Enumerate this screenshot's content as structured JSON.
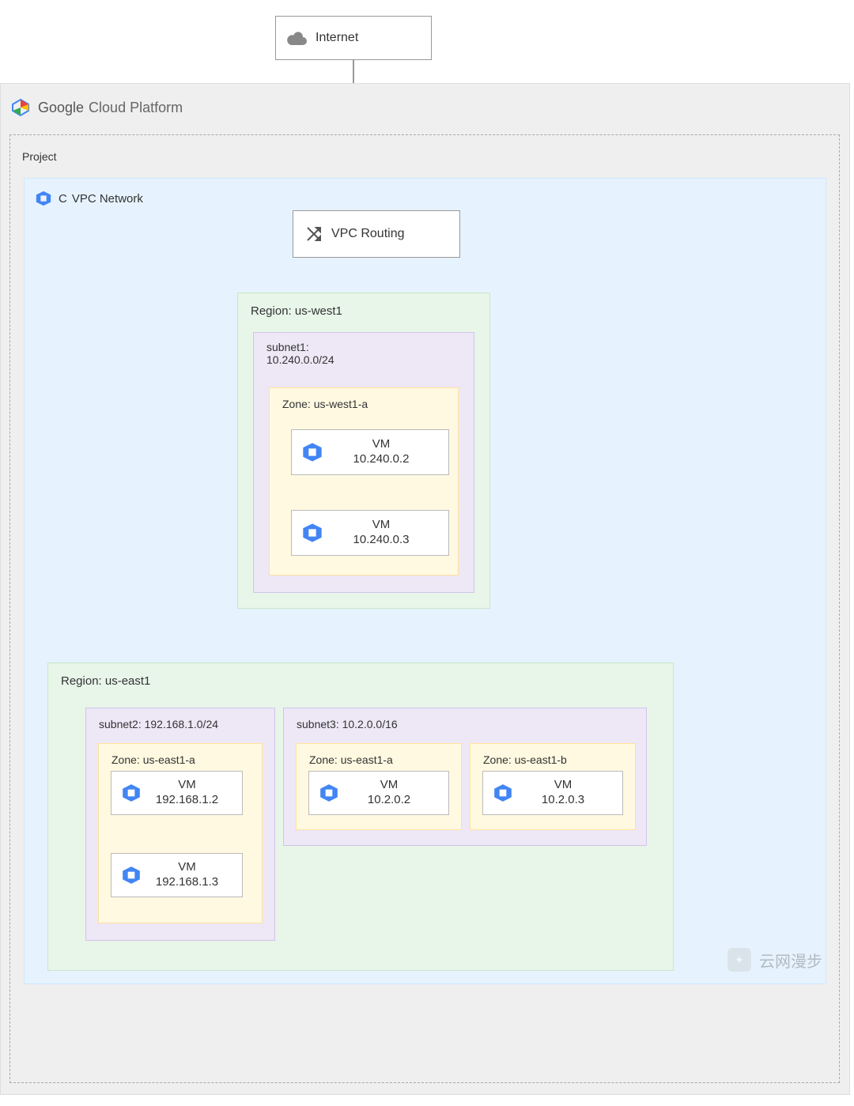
{
  "internet": {
    "label": "Internet"
  },
  "gcp": {
    "title_bold": "Google",
    "title_rest": "Cloud Platform"
  },
  "project": {
    "label": "Project"
  },
  "vpc": {
    "label": "VPC Network"
  },
  "routing": {
    "label": "VPC Routing"
  },
  "regions": [
    {
      "name": "Region: us-west1",
      "subnets": [
        {
          "name": "subnet1:\n10.240.0.0/24",
          "zones": [
            {
              "name": "Zone: us-west1-a",
              "vms": [
                {
                  "name": "VM",
                  "ip": "10.240.0.2"
                },
                {
                  "name": "VM",
                  "ip": "10.240.0.3"
                }
              ]
            }
          ]
        }
      ]
    },
    {
      "name": "Region: us-east1",
      "subnets": [
        {
          "name": "subnet2: 192.168.1.0/24",
          "zones": [
            {
              "name": "Zone: us-east1-a",
              "vms": [
                {
                  "name": "VM",
                  "ip": "192.168.1.2"
                },
                {
                  "name": "VM",
                  "ip": "192.168.1.3"
                }
              ]
            }
          ]
        },
        {
          "name": "subnet3: 10.2.0.0/16",
          "zones": [
            {
              "name": "Zone: us-east1-a",
              "vms": [
                {
                  "name": "VM",
                  "ip": "10.2.0.2"
                }
              ]
            },
            {
              "name": "Zone: us-east1-b",
              "vms": [
                {
                  "name": "VM",
                  "ip": "10.2.0.3"
                }
              ]
            }
          ]
        }
      ]
    }
  ],
  "watermark": "云网漫步"
}
